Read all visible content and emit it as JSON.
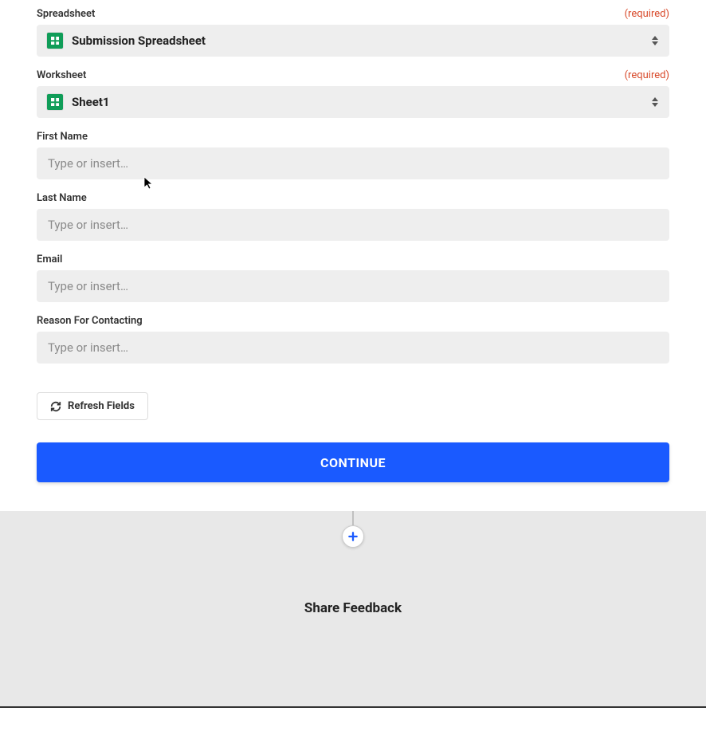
{
  "colors": {
    "primary": "#1a5aff",
    "required": "#d84a2b",
    "sheetsGreen": "#0f9d58"
  },
  "fields": {
    "spreadsheet": {
      "label": "Spreadsheet",
      "required_text": "(required)",
      "value": "Submission Spreadsheet"
    },
    "worksheet": {
      "label": "Worksheet",
      "required_text": "(required)",
      "value": "Sheet1"
    },
    "firstName": {
      "label": "First Name",
      "placeholder": "Type or insert…"
    },
    "lastName": {
      "label": "Last Name",
      "placeholder": "Type or insert…"
    },
    "email": {
      "label": "Email",
      "placeholder": "Type or insert…"
    },
    "reason": {
      "label": "Reason For Contacting",
      "placeholder": "Type or insert…"
    }
  },
  "buttons": {
    "refresh": "Refresh Fields",
    "continue": "CONTINUE"
  },
  "footer": {
    "share_feedback": "Share Feedback"
  }
}
